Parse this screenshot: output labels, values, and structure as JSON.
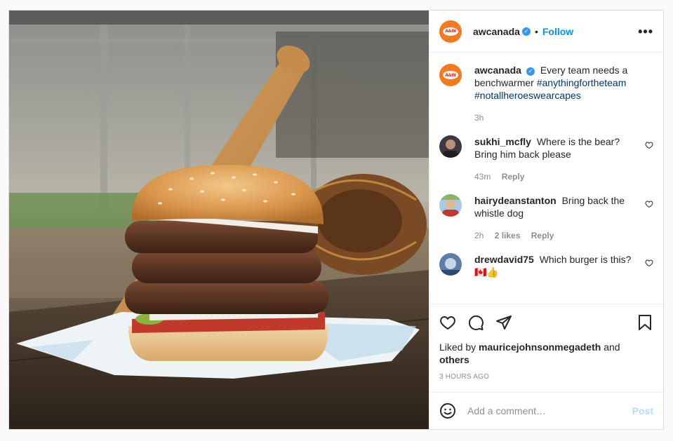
{
  "post": {
    "username": "awcanada",
    "follow_label": "Follow",
    "separator": "•",
    "more_label": "•••",
    "verified_mark": "✓",
    "logo_text": "A&W"
  },
  "caption": {
    "username": "awcanada",
    "text": "Every team needs a benchwarmer",
    "hashtag_1": "#anythingfortheteam",
    "hashtag_2": "#notallheroeswearcapes",
    "time": "3h"
  },
  "comments": [
    {
      "username": "sukhi_mcfly",
      "text": "Where is the bear? Bring him back please",
      "time": "43m",
      "likes": "",
      "reply_label": "Reply"
    },
    {
      "username": "hairydeanstanton",
      "text": "Bring back the whistle dog",
      "time": "2h",
      "likes": "2 likes",
      "reply_label": "Reply"
    },
    {
      "username": "drewdavid75",
      "text": "Which burger is this?🇨🇦👍",
      "time": "",
      "likes": "",
      "reply_label": ""
    }
  ],
  "actions": {
    "liked_by_prefix": "Liked by",
    "liked_by_user": "mauricejohnsonmegadeth",
    "liked_by_and": "and",
    "liked_by_others": "others",
    "timestamp": "3 HOURS AGO"
  },
  "add_comment": {
    "placeholder": "Add a comment…",
    "post_label": "Post"
  },
  "icons": [
    "heart-icon",
    "comment-icon",
    "share-icon",
    "bookmark-icon",
    "emoji-icon",
    "more-icon"
  ],
  "colors": {
    "accent": "#0095f6",
    "brand": "#f47a20",
    "verified": "#3897f0",
    "post_disabled": "#b3dbff"
  }
}
